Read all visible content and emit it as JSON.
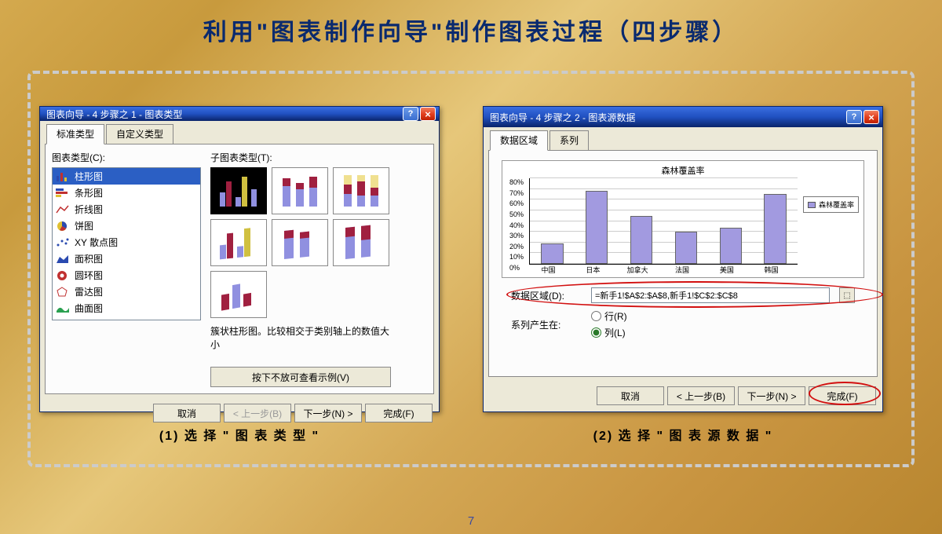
{
  "slide": {
    "title": "利用\"图表制作向导\"制作图表过程（四步骤）",
    "page_number": "7"
  },
  "dialog1": {
    "title": "图表向导 - 4 步骤之 1 - 图表类型",
    "tabs": {
      "standard": "标准类型",
      "custom": "自定义类型"
    },
    "chart_type_label": "图表类型(C):",
    "subtype_label": "子图表类型(T):",
    "types": [
      "柱形图",
      "条形图",
      "折线图",
      "饼图",
      "XY 散点图",
      "面积图",
      "圆环图",
      "雷达图",
      "曲面图"
    ],
    "desc": "簇状柱形图。比较相交于类别轴上的数值大小",
    "sample_btn": "按下不放可查看示例(V)",
    "buttons": {
      "cancel": "取消",
      "back": "< 上一步(B)",
      "next": "下一步(N) >",
      "finish": "完成(F)"
    },
    "caption": "(1) 选 择 \" 图 表 类 型 \""
  },
  "dialog2": {
    "title": "图表向导 - 4 步骤之 2 - 图表源数据",
    "tabs": {
      "range": "数据区域",
      "series": "系列"
    },
    "chart_title": "森林覆盖率",
    "legend": "森林覆盖率",
    "range_label": "数据区域(D):",
    "range_value": "=新手1!$A$2:$A$8,新手1!$C$2:$C$8",
    "series_in_label": "系列产生在:",
    "row_opt": "行(R)",
    "col_opt": "列(L)",
    "buttons": {
      "cancel": "取消",
      "back": "< 上一步(B)",
      "next": "下一步(N) >",
      "finish": "完成(F)"
    },
    "caption": "(2) 选 择 \" 图 表 源 数 据 \""
  },
  "chart_data": {
    "type": "bar",
    "title": "森林覆盖率",
    "categories": [
      "中国",
      "日本",
      "加拿大",
      "法国",
      "美国",
      "韩国"
    ],
    "values": [
      19,
      68,
      45,
      30,
      34,
      65
    ],
    "ylabel": "%",
    "ylim": [
      0,
      80
    ],
    "yticks": [
      0,
      10,
      20,
      30,
      40,
      50,
      60,
      70,
      80
    ],
    "series_name": "森林覆盖率"
  }
}
